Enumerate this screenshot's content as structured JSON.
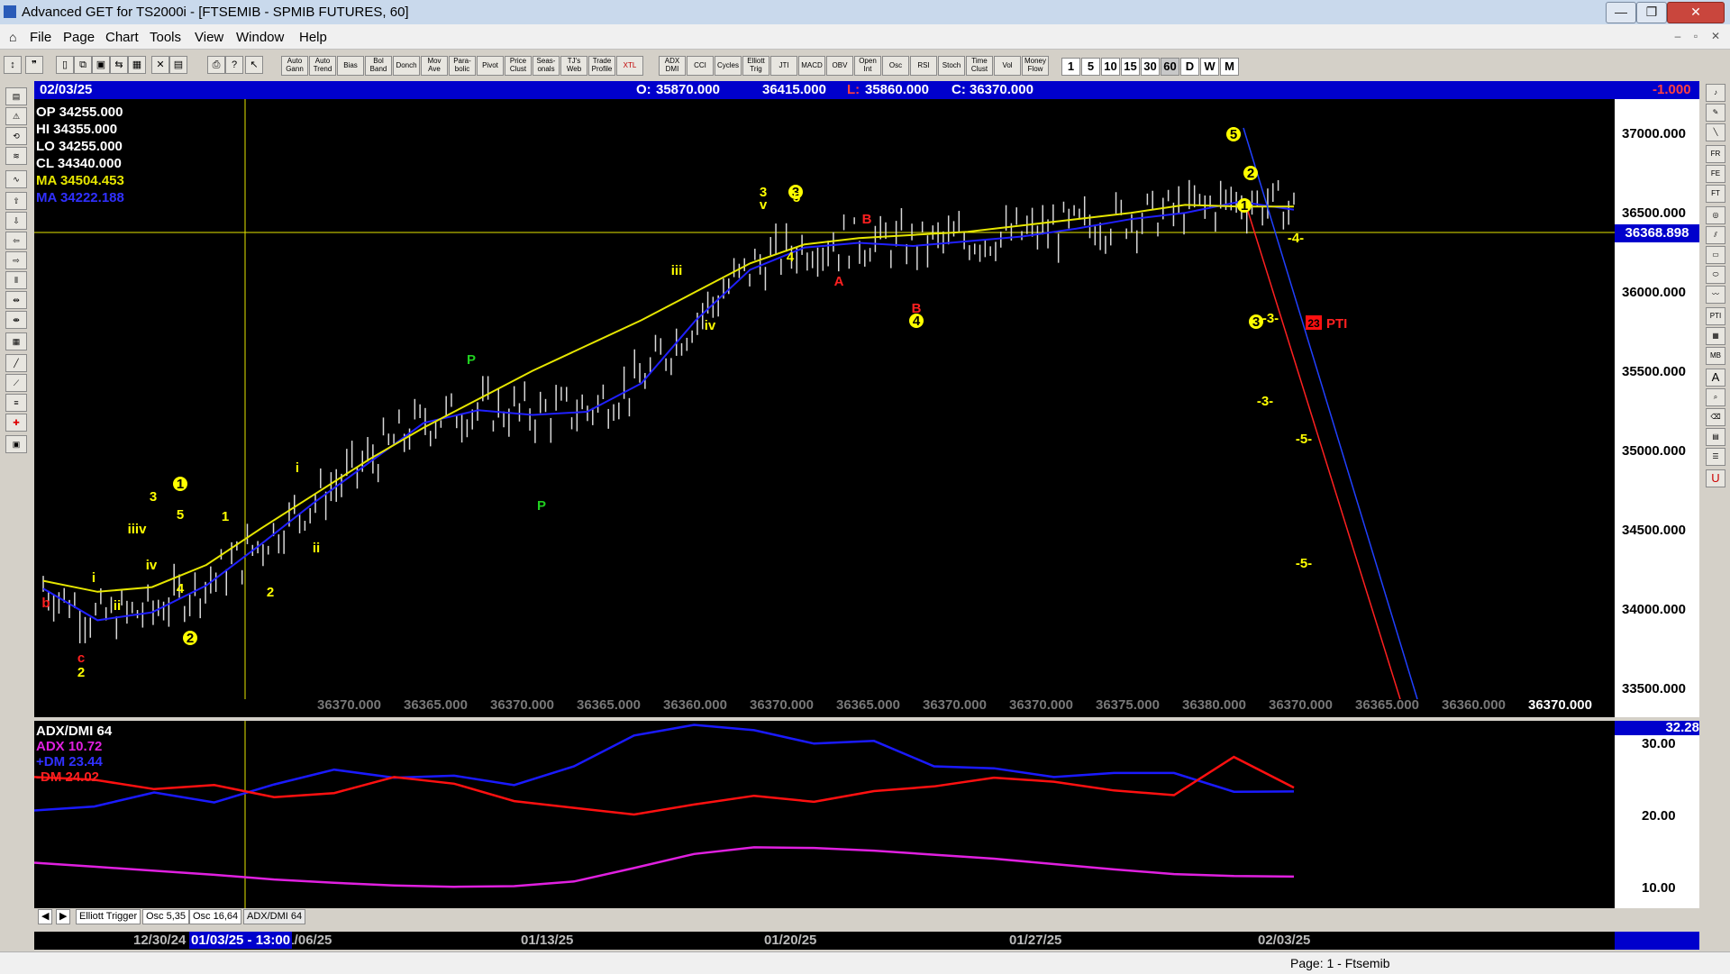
{
  "window": {
    "title": "Advanced GET for TS2000i - [FTSEMIB - SPMIB FUTURES, 60]",
    "controls": [
      "—",
      "❐",
      "✕"
    ]
  },
  "menu": [
    "File",
    "Page",
    "Chart",
    "Tools",
    "View",
    "Window",
    "Help"
  ],
  "toolbar": {
    "study_buttons": [
      "Auto Gann",
      "Auto Trend",
      "Bias",
      "Bol Band",
      "Donch",
      "Mov Ave",
      "Para-bolic",
      "Pivot",
      "Price Clust",
      "Seas-onals",
      "TJ's Web",
      "Trade Profile",
      "XTL",
      "ADX DMI",
      "CCI",
      "Cycles",
      "Elliott Trig",
      "JTI",
      "MACD",
      "OBV",
      "Open Int",
      "Osc",
      "RSI",
      "Stoch",
      "Time Clust",
      "Vol",
      "Money Flow"
    ],
    "timeframes": [
      "1",
      "5",
      "10",
      "15",
      "30",
      "60",
      "D",
      "W",
      "M"
    ],
    "selected_timeframe": "60"
  },
  "header": {
    "date": "02/03/25",
    "open_label": "O:",
    "open": "35870.000",
    "high": "36415.000",
    "low_label": "L:",
    "low": "35860.000",
    "close_label": "C:",
    "close": "36370.000",
    "change": "-1.000"
  },
  "ohlc_readout": {
    "op": "OP  34255.000",
    "hi": "HI   34355.000",
    "lo": "LO  34255.000",
    "cl": "CL   34340.000",
    "ma1": "MA  34504.453",
    "ma2": "MA  34222.188"
  },
  "price_axis": {
    "ticks": [
      "37000.000",
      "36500.000",
      "36000.000",
      "35500.000",
      "35000.000",
      "34500.000",
      "34000.000",
      "33500.000"
    ],
    "last_price": "36368.898"
  },
  "x_value_labels": [
    "36370.000",
    "36365.000",
    "36370.000",
    "36365.000",
    "36360.000",
    "36370.000",
    "36365.000",
    "36370.000",
    "36370.000",
    "36375.000",
    "36380.000",
    "36370.000",
    "36365.000",
    "36360.000",
    "36370.000"
  ],
  "wave_labels": {
    "b": "b",
    "c": "c",
    "two": "2",
    "i": "i",
    "ii": "ii",
    "iii": "iii",
    "iv": "iv",
    "v": "v",
    "one": "1",
    "three": "3",
    "four": "4",
    "five": "5",
    "P": "P",
    "A": "A",
    "B": "B",
    "m3": "-3-",
    "m4": "-4-",
    "m5": "-5-",
    "pti": "PTI",
    "pti_val": "23"
  },
  "indicator": {
    "name": "ADX/DMI 64",
    "adx": "ADX 10.72",
    "pdm": "+DM 23.44",
    "mdm": "-DM  24.02",
    "box_value": "32.28",
    "ticks": [
      "30.00",
      "20.00",
      "10.00"
    ]
  },
  "tabs": [
    "Elliott Trigger",
    "Osc 5,35",
    "Osc 16,64",
    "ADX/DMI 64"
  ],
  "date_axis": {
    "labels": [
      "12/30/24",
      "01/06/25",
      "01/13/25",
      "01/20/25",
      "01/27/25",
      "02/03/25"
    ],
    "cursor_label": "01/03/25 - 13:00"
  },
  "status": {
    "page": "Page: 1 - Ftsemib"
  },
  "colors": {
    "chart_bg": "#000000",
    "header_blue": "#0000cc",
    "ma_fast": "#e6e600",
    "ma_slow": "#2020ff",
    "adx": "#e020e0",
    "plus_dm": "#1a1aff",
    "minus_dm": "#ff1010",
    "wave_yellow": "#ffff00",
    "wave_red": "#ff2020",
    "wave_green": "#20d020"
  },
  "chart_data": {
    "type": "candlestick",
    "series": [
      {
        "name": "MA 34504.453",
        "values": [
          34150,
          34080,
          34110,
          34250,
          34480,
          34700,
          34920,
          35120,
          35300,
          35480,
          35640,
          35800,
          35980,
          36160,
          36280,
          36320,
          36340,
          36360,
          36400,
          36440,
          36480,
          36530,
          36520,
          36520
        ]
      },
      {
        "name": "MA 34222.188",
        "values": [
          34100,
          33900,
          33950,
          34120,
          34380,
          34650,
          34900,
          35150,
          35230,
          35200,
          35220,
          35400,
          35800,
          36120,
          36260,
          36290,
          36270,
          36300,
          36330,
          36380,
          36440,
          36480,
          36550,
          36500
        ]
      }
    ],
    "ylim": [
      33400,
      37200
    ],
    "indicator_series": [
      {
        "name": "ADX",
        "values": [
          12.8,
          12.2,
          11.6,
          11.0,
          10.3,
          9.8,
          9.4,
          9.2,
          9.3,
          10.0,
          12.0,
          14.1,
          15.1,
          15.0,
          14.6,
          14.0,
          13.4,
          12.6,
          11.8,
          11.1,
          10.8,
          10.72
        ]
      },
      {
        "name": "+DM",
        "values": [
          20.6,
          21.2,
          23.3,
          21.8,
          24.5,
          26.7,
          25.5,
          25.8,
          24.4,
          27.2,
          31.8,
          33.4,
          32.6,
          30.6,
          31.0,
          27.2,
          26.9,
          25.6,
          26.2,
          26.2,
          23.4,
          23.44
        ]
      },
      {
        "name": "-DM",
        "values": [
          25.6,
          25.2,
          23.8,
          24.4,
          22.6,
          23.2,
          25.6,
          24.6,
          22.0,
          21.0,
          20.0,
          21.5,
          22.8,
          21.9,
          23.5,
          24.2,
          25.5,
          24.9,
          23.6,
          22.9,
          28.6,
          24.02
        ]
      }
    ],
    "indicator_ylim": [
      6,
      34
    ]
  }
}
